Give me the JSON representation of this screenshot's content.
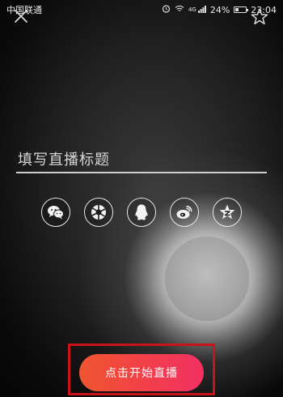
{
  "status_bar": {
    "carrier": "中国联通",
    "network": "4G",
    "battery": "24%",
    "time": "23:04"
  },
  "top_bar": {
    "close_icon": "close-icon",
    "favorite_icon": "star-icon"
  },
  "title_input": {
    "placeholder": "填写直播标题",
    "value": ""
  },
  "share": {
    "items": [
      {
        "name": "wechat",
        "icon": "wechat-icon"
      },
      {
        "name": "moments",
        "icon": "moments-icon"
      },
      {
        "name": "qq",
        "icon": "qq-icon"
      },
      {
        "name": "weibo",
        "icon": "weibo-icon"
      },
      {
        "name": "qzone",
        "icon": "qzone-icon"
      }
    ]
  },
  "actions": {
    "start_label": "点击开始直播"
  },
  "colors": {
    "accent_gradient_start": "#f0552f",
    "accent_gradient_end": "#f23062",
    "highlight_border": "#c8131b",
    "icon_stroke": "#e8e8e8"
  }
}
